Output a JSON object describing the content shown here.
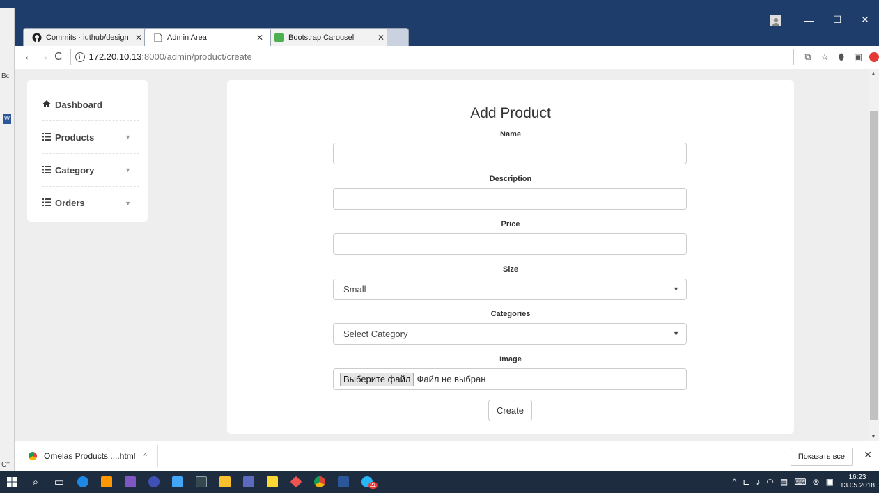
{
  "desktop": {
    "side_text_1": "Вс",
    "side_text_2": "Ст"
  },
  "tabs": [
    {
      "label": "Commits · iuthub/design",
      "icon": "github-icon"
    },
    {
      "label": "Admin Area",
      "icon": "page-icon"
    },
    {
      "label": "Bootstrap Carousel",
      "icon": "w3schools-icon"
    }
  ],
  "toolbar": {
    "url_host": "172.20.10.13",
    "url_path": ":8000/admin/product/create"
  },
  "sidebar": {
    "items": [
      {
        "label": "Dashboard",
        "icon": "home-icon"
      },
      {
        "label": "Products",
        "icon": "list-icon"
      },
      {
        "label": "Category",
        "icon": "list-icon"
      },
      {
        "label": "Orders",
        "icon": "list-icon"
      }
    ]
  },
  "form": {
    "title": "Add Product",
    "name_label": "Name",
    "name_value": "",
    "description_label": "Description",
    "description_value": "",
    "price_label": "Price",
    "price_value": "",
    "size_label": "Size",
    "size_value": "Small",
    "categories_label": "Categories",
    "categories_value": "Select Category",
    "image_label": "Image",
    "file_button": "Выберите файл",
    "file_status": "Файл не выбран",
    "create_label": "Create"
  },
  "download_bar": {
    "item": "Omelas Products ....html",
    "show_all": "Показать все"
  },
  "taskbar": {
    "time": "16:23",
    "date": "13.05.2018",
    "badge": "21"
  },
  "colors": {
    "titlebar": "#1f3d6b",
    "page_bg": "#eeeeee",
    "taskbar": "#1e2c40"
  }
}
